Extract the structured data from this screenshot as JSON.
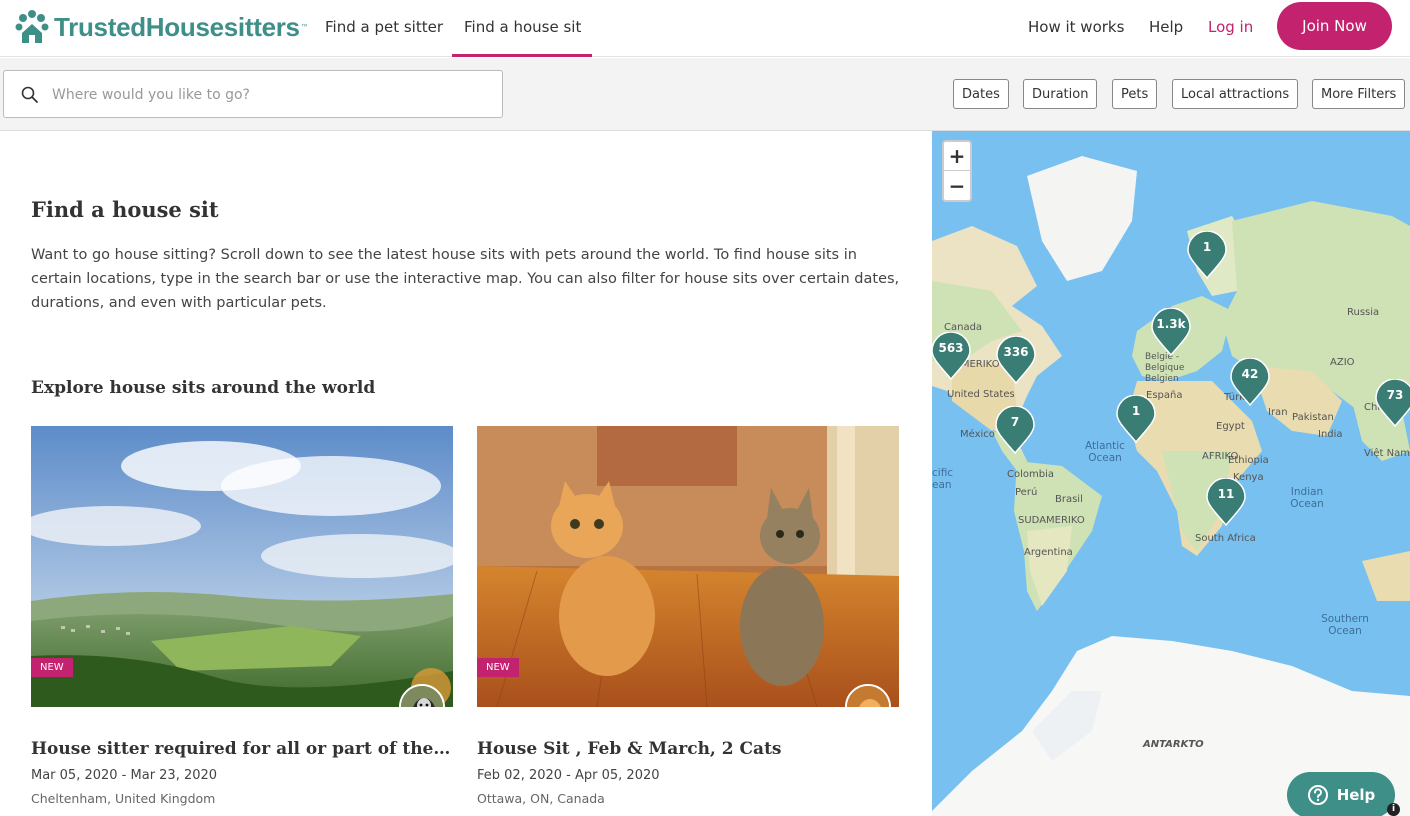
{
  "brand": {
    "name": "TrustedHousesitters",
    "tm": "™",
    "accent": "#c2226e",
    "brand_color": "#3d8f87"
  },
  "header": {
    "nav": [
      "Find a pet sitter",
      "Find a house sit"
    ],
    "active_nav": "Find a house sit",
    "how_it_works": "How it works",
    "help": "Help",
    "login": "Log in",
    "join": "Join Now"
  },
  "search": {
    "placeholder": "Where would you like to go?",
    "filters": [
      "Dates",
      "Duration",
      "Pets",
      "Local attractions",
      "More Filters"
    ]
  },
  "main": {
    "title": "Find a house sit",
    "intro": "Want to go house sitting? Scroll down to see the latest house sits with pets around the world. To find house sits in certain locations, type in the search bar or use the interactive map. You can also filter for house sits over certain dates, durations, and even with particular pets.",
    "explore_title": "Explore house sits around the world",
    "cards": [
      {
        "badge": "NEW",
        "title": "House sitter required for all or part of the dates…",
        "dates": "Mar 05, 2020 - Mar 23, 2020",
        "location": "Cheltenham, United Kingdom"
      },
      {
        "badge": "NEW",
        "title": "House Sit , Feb & March, 2 Cats",
        "dates": "Feb 02, 2020 - Apr 05, 2020",
        "location": "Ottawa, ON, Canada"
      }
    ]
  },
  "map": {
    "zoom_in": "+",
    "zoom_out": "−",
    "markers": [
      "1",
      "1.3k",
      "563",
      "336",
      "42",
      "73",
      "1",
      "7",
      "11"
    ],
    "labels": {
      "canada": "Canada",
      "us": "United States",
      "amerika": "AMERIKO",
      "mexico": "México",
      "colombia": "Colombia",
      "peru": "Perú",
      "brasil": "Brasil",
      "sudameriko": "SUDAMERIKO",
      "argentina": "Argentina",
      "atlantic": "Atlantic Ocean",
      "pacific": "cific ean",
      "russia": "Russia",
      "azio": "AZIO",
      "belgie": "België - Belgique Belgien",
      "espana": "España",
      "turk": "Türk",
      "iran": "Iran",
      "pakistan": "Pakistan",
      "india": "India",
      "chi": "Chi",
      "vietnam": "Việt Nam",
      "egypt": "Egypt",
      "afriko": "AFRIKO",
      "ethiopia": "Ethiopia",
      "kenya": "Kenya",
      "indian": "Indian Ocean",
      "southafrica": "South Africa",
      "southern": "Southern Ocean",
      "antarkto": "ANTARKTO"
    },
    "help": "Help",
    "info": "i"
  }
}
